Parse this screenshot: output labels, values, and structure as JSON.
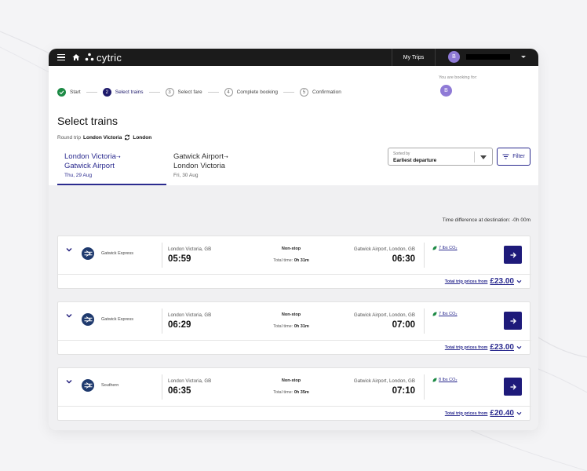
{
  "topbar": {
    "brand": "cytric",
    "my_trips": "My Trips",
    "user_initial": "B"
  },
  "booking_for": {
    "label": "You are booking for:",
    "initial": "B"
  },
  "stepper": [
    {
      "number": "",
      "label": "Start",
      "state": "done"
    },
    {
      "number": "2",
      "label": "Select trains",
      "state": "active"
    },
    {
      "number": "3",
      "label": "Select fare",
      "state": "todo"
    },
    {
      "number": "4",
      "label": "Complete booking",
      "state": "todo"
    },
    {
      "number": "5",
      "label": "Confirmation",
      "state": "todo"
    }
  ],
  "page": {
    "title": "Select trains",
    "roundtrip_prefix": "Round trip",
    "origin": "London Victoria",
    "destination": "London"
  },
  "route_tabs": [
    {
      "from": "London Victoria",
      "to": "Gatwick Airport",
      "date": "Thu, 29 Aug",
      "selected": true
    },
    {
      "from": "Gatwick Airport",
      "to": "London Victoria",
      "date": "Fri, 30 Aug",
      "selected": false
    }
  ],
  "sort": {
    "label": "Sorted by",
    "value": "Earliest departure"
  },
  "filter_label": "Filter",
  "time_difference": "Time difference at destination: -0h 00m",
  "trains": [
    {
      "operator": "Gatwick Express",
      "from": "London Victoria, GB",
      "dep": "05:59",
      "stops": "Non-stop",
      "total_label": "Total time:",
      "duration": "0h 31m",
      "to": "Gatwick Airport, London, GB",
      "arr": "06:30",
      "co2": "7 lbs CO₂",
      "price_label": "Total trip prices from",
      "price": "£23.00"
    },
    {
      "operator": "Gatwick Express",
      "from": "London Victoria, GB",
      "dep": "06:29",
      "stops": "Non-stop",
      "total_label": "Total time:",
      "duration": "0h 31m",
      "to": "Gatwick Airport, London, GB",
      "arr": "07:00",
      "co2": "7 lbs CO₂",
      "price_label": "Total trip prices from",
      "price": "£23.00"
    },
    {
      "operator": "Southern",
      "from": "London Victoria, GB",
      "dep": "06:35",
      "stops": "Non-stop",
      "total_label": "Total time:",
      "duration": "0h 35m",
      "to": "Gatwick Airport, London, GB",
      "arr": "07:10",
      "co2": "8 lbs CO₂",
      "price_label": "Total trip prices from",
      "price": "£20.40"
    }
  ],
  "colors": {
    "primary": "#1e1a7a",
    "success": "#1d8a45",
    "avatar": "#8f7ad6",
    "topbar": "#1b1b1b"
  }
}
